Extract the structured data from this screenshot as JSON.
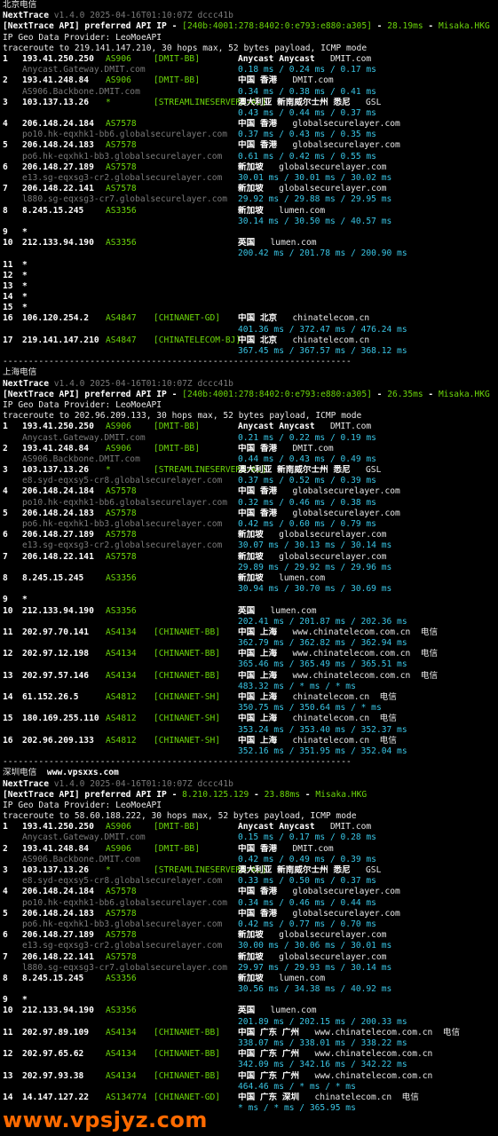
{
  "colors": {
    "hop_ip": "#ffffff",
    "asn": "#6cd60a",
    "latency": "#39c5e5",
    "hostname": "#7a7a7a",
    "header_green": "#6cd60a",
    "watermark": "#ff6a00"
  },
  "watermark": "www.vpsjyz.com",
  "sections": [
    {
      "title": "北京电信",
      "title_extra": "",
      "tool_name": "NextTrace",
      "tool_meta": "v1.4.0 2025-04-16T01:10:07Z dccc41b",
      "api_prefix": "[NextTrace API] preferred API IP - ",
      "api_ip": "[240b:4001:278:8402:0:e793:e880:a305]",
      "api_latency": "28.19ms",
      "api_node": "Misaka.HKG",
      "geo_provider": "IP Geo Data Provider: LeoMoeAPI",
      "traceroute": "traceroute to 219.141.147.210, 30 hops max, 52 bytes payload, ICMP mode",
      "hops": [
        {
          "n": "1",
          "ip": "193.41.250.250",
          "asn": "AS906",
          "tag": "[DMIT-BB]",
          "geo": "Anycast Anycast",
          "host": "DMIT.com",
          "rdns": "Anycast.Gateway.DMIT.com",
          "lat": "0.18 ms / 0.24 ms / 0.17 ms"
        },
        {
          "n": "2",
          "ip": "193.41.248.84",
          "asn": "AS906",
          "tag": "[DMIT-BB]",
          "geo": "中国 香港",
          "host": "DMIT.com",
          "rdns": "AS906.Backbone.DMIT.com",
          "lat": "0.34 ms / 0.38 ms / 0.41 ms"
        },
        {
          "n": "3",
          "ip": "103.137.13.26",
          "asn": "*",
          "tag": "[STREAMLINESERVERS-AU]",
          "geo": "澳大利亚 新南威尔士州 悉尼",
          "host": "GSL",
          "rdns": "",
          "lat": "0.43 ms / 0.44 ms / 0.37 ms"
        },
        {
          "n": "4",
          "ip": "206.148.24.184",
          "asn": "AS7578",
          "tag": "",
          "geo": "中国 香港",
          "host": "globalsecurelayer.com",
          "rdns": "po10.hk-eqxhk1-bb6.globalsecurelayer.com",
          "lat": "0.37 ms / 0.43 ms / 0.35 ms"
        },
        {
          "n": "5",
          "ip": "206.148.24.183",
          "asn": "AS7578",
          "tag": "",
          "geo": "中国 香港",
          "host": "globalsecurelayer.com",
          "rdns": "po6.hk-eqxhk1-bb3.globalsecurelayer.com",
          "lat": "0.61 ms / 0.42 ms / 0.55 ms"
        },
        {
          "n": "6",
          "ip": "206.148.27.189",
          "asn": "AS7578",
          "tag": "",
          "geo": "新加坡",
          "host": "globalsecurelayer.com",
          "rdns": "e13.sg-eqxsg3-cr2.globalsecurelayer.com",
          "lat": "30.01 ms / 30.01 ms / 30.02 ms"
        },
        {
          "n": "7",
          "ip": "206.148.22.141",
          "asn": "AS7578",
          "tag": "",
          "geo": "新加坡",
          "host": "globalsecurelayer.com",
          "rdns": "l880.sg-eqxsg3-cr7.globalsecurelayer.com",
          "lat": "29.92 ms / 29.88 ms / 29.95 ms"
        },
        {
          "n": "8",
          "ip": "8.245.15.245",
          "asn": "AS3356",
          "tag": "",
          "geo": "新加坡",
          "host": "lumen.com",
          "rdns": "",
          "lat": "30.14 ms / 30.50 ms / 40.57 ms"
        },
        {
          "n": "9",
          "ip": "*"
        },
        {
          "n": "10",
          "ip": "212.133.94.190",
          "asn": "AS3356",
          "tag": "",
          "geo": "英国",
          "host": "lumen.com",
          "rdns": "",
          "lat": "200.42 ms / 201.78 ms / 200.90 ms"
        },
        {
          "n": "11",
          "ip": "*"
        },
        {
          "n": "12",
          "ip": "*"
        },
        {
          "n": "13",
          "ip": "*"
        },
        {
          "n": "14",
          "ip": "*"
        },
        {
          "n": "15",
          "ip": "*"
        },
        {
          "n": "16",
          "ip": "106.120.254.2",
          "asn": "AS4847",
          "tag": "[CHINANET-GD]",
          "geo": "中国 北京",
          "host": "chinatelecom.cn",
          "rdns": "",
          "lat": "401.36 ms / 372.47 ms / 476.24 ms"
        },
        {
          "n": "17",
          "ip": "219.141.147.210",
          "asn": "AS4847",
          "tag": "[CHINATELECOM-BJ]",
          "geo": "中国 北京",
          "host": "chinatelecom.cn",
          "rdns": "",
          "lat": "367.45 ms / 367.57 ms / 368.12 ms"
        }
      ]
    },
    {
      "title": "上海电信",
      "title_extra": "",
      "tool_name": "NextTrace",
      "tool_meta": "v1.4.0 2025-04-16T01:10:07Z dccc41b",
      "api_prefix": "[NextTrace API] preferred API IP - ",
      "api_ip": "[240b:4001:278:8402:0:e793:e880:a305]",
      "api_latency": "26.35ms",
      "api_node": "Misaka.HKG",
      "geo_provider": "IP Geo Data Provider: LeoMoeAPI",
      "traceroute": "traceroute to 202.96.209.133, 30 hops max, 52 bytes payload, ICMP mode",
      "hops": [
        {
          "n": "1",
          "ip": "193.41.250.250",
          "asn": "AS906",
          "tag": "[DMIT-BB]",
          "geo": "Anycast Anycast",
          "host": "DMIT.com",
          "rdns": "Anycast.Gateway.DMIT.com",
          "lat": "0.21 ms / 0.22 ms / 0.19 ms"
        },
        {
          "n": "2",
          "ip": "193.41.248.84",
          "asn": "AS906",
          "tag": "[DMIT-BB]",
          "geo": "中国 香港",
          "host": "DMIT.com",
          "rdns": "AS906.Backbone.DMIT.com",
          "lat": "0.44 ms / 0.43 ms / 0.49 ms"
        },
        {
          "n": "3",
          "ip": "103.137.13.26",
          "asn": "*",
          "tag": "[STREAMLINESERVERS-AU]",
          "geo": "澳大利亚 新南威尔士州 悉尼",
          "host": "GSL",
          "rdns": "e8.syd-eqxsy5-cr8.globalsecurelayer.com",
          "lat": "0.37 ms / 0.52 ms / 0.39 ms",
          "rdns_inline": true
        },
        {
          "n": "4",
          "ip": "206.148.24.184",
          "asn": "AS7578",
          "tag": "",
          "geo": "中国 香港",
          "host": "globalsecurelayer.com",
          "rdns": "po10.hk-eqxhk1-bb6.globalsecurelayer.com",
          "lat": "0.32 ms / 0.46 ms / 0.38 ms",
          "rdns_inline": true
        },
        {
          "n": "5",
          "ip": "206.148.24.183",
          "asn": "AS7578",
          "tag": "",
          "geo": "中国 香港",
          "host": "globalsecurelayer.com",
          "rdns": "po6.hk-eqxhk1-bb3.globalsecurelayer.com",
          "lat": "0.42 ms / 0.60 ms / 0.79 ms",
          "rdns_inline": true
        },
        {
          "n": "6",
          "ip": "206.148.27.189",
          "asn": "AS7578",
          "tag": "",
          "geo": "新加坡",
          "host": "globalsecurelayer.com",
          "rdns": "e13.sg-eqxsg3-cr2.globalsecurelayer.com",
          "lat": "30.07 ms / 30.13 ms / 30.14 ms",
          "rdns_inline": true
        },
        {
          "n": "7",
          "ip": "206.148.22.141",
          "asn": "AS7578",
          "tag": "",
          "geo": "新加坡",
          "host": "globalsecurelayer.com",
          "rdns": "",
          "lat": "29.89 ms / 29.92 ms / 29.96 ms"
        },
        {
          "n": "8",
          "ip": "8.245.15.245",
          "asn": "AS3356",
          "tag": "",
          "geo": "新加坡",
          "host": "lumen.com",
          "rdns": "",
          "lat": "30.94 ms / 30.70 ms / 30.69 ms"
        },
        {
          "n": "9",
          "ip": "*"
        },
        {
          "n": "10",
          "ip": "212.133.94.190",
          "asn": "AS3356",
          "tag": "",
          "geo": "英国",
          "host": "lumen.com",
          "rdns": "",
          "lat": "202.41 ms / 201.87 ms / 202.36 ms"
        },
        {
          "n": "11",
          "ip": "202.97.70.141",
          "asn": "AS4134",
          "tag": "[CHINANET-BB]",
          "geo": "中国 上海",
          "host": "www.chinatelecom.com.cn  电信",
          "rdns": "",
          "lat": "362.79 ms / 362.82 ms / 362.94 ms"
        },
        {
          "n": "12",
          "ip": "202.97.12.198",
          "asn": "AS4134",
          "tag": "[CHINANET-BB]",
          "geo": "中国 上海",
          "host": "www.chinatelecom.com.cn  电信",
          "rdns": "",
          "lat": "365.46 ms / 365.49 ms / 365.51 ms"
        },
        {
          "n": "13",
          "ip": "202.97.57.146",
          "asn": "AS4134",
          "tag": "[CHINANET-BB]",
          "geo": "中国 上海",
          "host": "www.chinatelecom.com.cn  电信",
          "rdns": "",
          "lat": "483.32 ms / * ms / * ms"
        },
        {
          "n": "14",
          "ip": "61.152.26.5",
          "asn": "AS4812",
          "tag": "[CHINANET-SH]",
          "geo": "中国 上海",
          "host": "chinatelecom.cn  电信",
          "rdns": "",
          "lat": "350.75 ms / 350.64 ms / * ms"
        },
        {
          "n": "15",
          "ip": "180.169.255.110",
          "asn": "AS4812",
          "tag": "[CHINANET-SH]",
          "geo": "中国 上海",
          "host": "chinatelecom.cn  电信",
          "rdns": "",
          "lat": "353.24 ms / 353.40 ms / 352.37 ms"
        },
        {
          "n": "16",
          "ip": "202.96.209.133",
          "asn": "AS4812",
          "tag": "[CHINANET-SH]",
          "geo": "中国 上海",
          "host": "chinatelecom.cn  电信",
          "rdns": "",
          "lat": "352.16 ms / 351.95 ms / 352.04 ms"
        }
      ]
    },
    {
      "title": "深圳电信",
      "title_extra": "www.vpsxxs.com",
      "tool_name": "NextTrace",
      "tool_meta": "v1.4.0 2025-04-16T01:10:07Z dccc41b",
      "api_prefix": "[NextTrace API] preferred API IP - ",
      "api_ip": "8.210.125.129",
      "api_latency": "23.88ms",
      "api_node": "Misaka.HKG",
      "geo_provider": "IP Geo Data Provider: LeoMoeAPI",
      "traceroute": "traceroute to 58.60.188.222, 30 hops max, 52 bytes payload, ICMP mode",
      "hops": [
        {
          "n": "1",
          "ip": "193.41.250.250",
          "asn": "AS906",
          "tag": "[DMIT-BB]",
          "geo": "Anycast Anycast",
          "host": "DMIT.com",
          "rdns": "Anycast.Gateway.DMIT.com",
          "lat": "0.15 ms / 0.17 ms / 0.28 ms",
          "rdns_inline": true
        },
        {
          "n": "2",
          "ip": "193.41.248.84",
          "asn": "AS906",
          "tag": "[DMIT-BB]",
          "geo": "中国 香港",
          "host": "DMIT.com",
          "rdns": "AS906.Backbone.DMIT.com",
          "lat": "0.42 ms / 0.49 ms / 0.39 ms",
          "rdns_inline": true
        },
        {
          "n": "3",
          "ip": "103.137.13.26",
          "asn": "*",
          "tag": "[STREAMLINESERVERS-AU]",
          "geo": "澳大利亚 新南威尔士州 悉尼",
          "host": "GSL",
          "rdns": "e8.syd-eqxsy5-cr8.globalsecurelayer.com",
          "lat": "0.33 ms / 0.50 ms / 0.37 ms",
          "rdns_inline": true
        },
        {
          "n": "4",
          "ip": "206.148.24.184",
          "asn": "AS7578",
          "tag": "",
          "geo": "中国 香港",
          "host": "globalsecurelayer.com",
          "rdns": "po10.hk-eqxhk1-bb6.globalsecurelayer.com",
          "lat": "0.34 ms / 0.46 ms / 0.44 ms",
          "rdns_inline": true
        },
        {
          "n": "5",
          "ip": "206.148.24.183",
          "asn": "AS7578",
          "tag": "",
          "geo": "中国 香港",
          "host": "globalsecurelayer.com",
          "rdns": "po6.hk-eqxhk1-bb3.globalsecurelayer.com",
          "lat": "0.42 ms / 0.77 ms / 0.70 ms",
          "rdns_inline": true
        },
        {
          "n": "6",
          "ip": "206.148.27.189",
          "asn": "AS7578",
          "tag": "",
          "geo": "新加坡",
          "host": "globalsecurelayer.com",
          "rdns": "e13.sg-eqxsg3-cr2.globalsecurelayer.com",
          "lat": "30.00 ms / 30.06 ms / 30.01 ms",
          "rdns_inline": true
        },
        {
          "n": "7",
          "ip": "206.148.22.141",
          "asn": "AS7578",
          "tag": "",
          "geo": "新加坡",
          "host": "globalsecurelayer.com",
          "rdns": "l880.sg-eqxsg3-cr7.globalsecurelayer.com",
          "lat": "29.97 ms / 29.93 ms / 30.14 ms",
          "rdns_inline": true
        },
        {
          "n": "8",
          "ip": "8.245.15.245",
          "asn": "AS3356",
          "tag": "",
          "geo": "新加坡",
          "host": "lumen.com",
          "rdns": "",
          "lat": "30.56 ms / 34.38 ms / 40.92 ms"
        },
        {
          "n": "9",
          "ip": "*"
        },
        {
          "n": "10",
          "ip": "212.133.94.190",
          "asn": "AS3356",
          "tag": "",
          "geo": "英国",
          "host": "lumen.com",
          "rdns": "",
          "lat": "201.89 ms / 202.15 ms / 200.33 ms"
        },
        {
          "n": "11",
          "ip": "202.97.89.109",
          "asn": "AS4134",
          "tag": "[CHINANET-BB]",
          "geo": "中国 广东 广州",
          "host": "www.chinatelecom.com.cn  电信",
          "rdns": "",
          "lat": "338.07 ms / 338.01 ms / 338.22 ms"
        },
        {
          "n": "12",
          "ip": "202.97.65.62",
          "asn": "AS4134",
          "tag": "[CHINANET-BB]",
          "geo": "中国 广东 广州",
          "host": "www.chinatelecom.com.cn",
          "rdns": "",
          "lat": "342.09 ms / 342.16 ms / 342.22 ms"
        },
        {
          "n": "13",
          "ip": "202.97.93.38",
          "asn": "AS4134",
          "tag": "[CHINANET-BB]",
          "geo": "中国 广东 广州",
          "host": "www.chinatelecom.com.cn",
          "rdns": "",
          "lat": "464.46 ms / * ms / * ms"
        },
        {
          "n": "14",
          "ip": "14.147.127.22",
          "asn": "AS134774",
          "tag": "[CHINANET-GD]",
          "geo": "中国 广东 深圳",
          "host": "chinatelecom.cn  电信",
          "rdns": "",
          "lat": "* ms / * ms / 365.95 ms"
        }
      ]
    }
  ],
  "separator": "--------------------------------------------------------------------"
}
